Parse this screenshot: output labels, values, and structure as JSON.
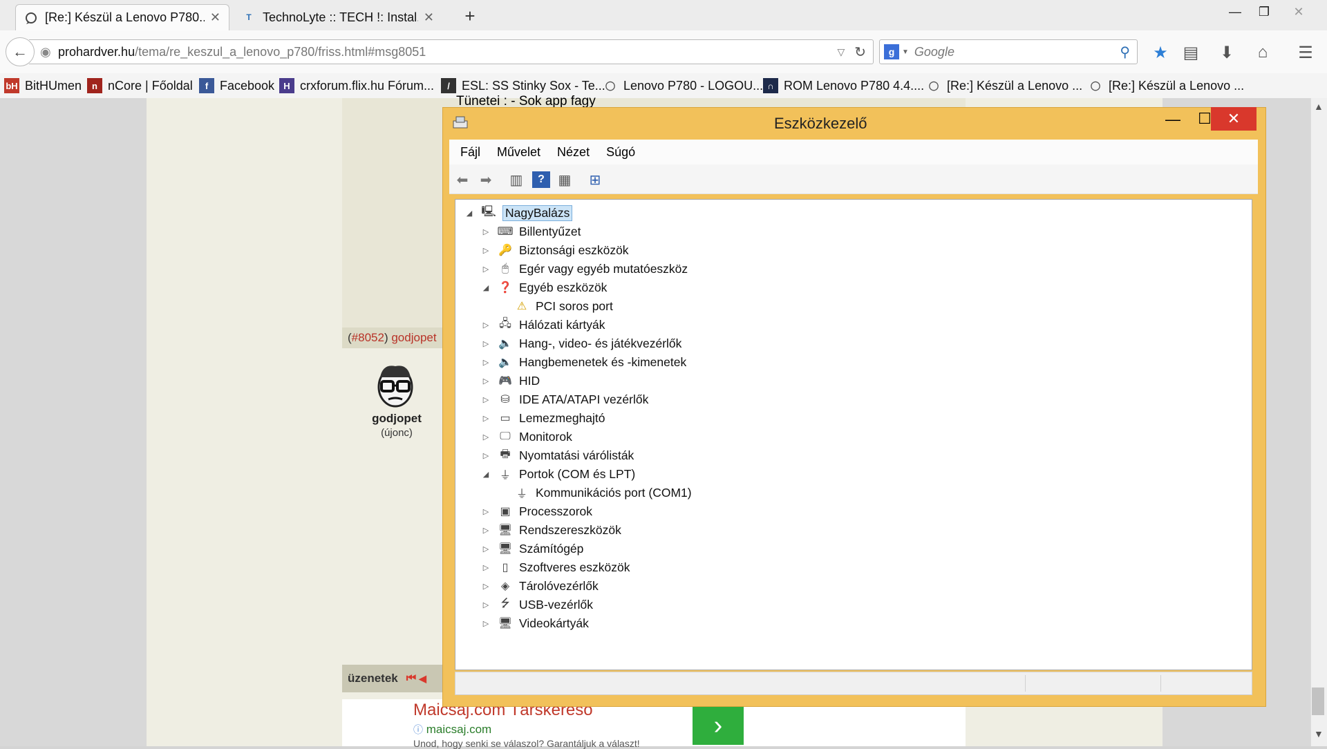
{
  "browser": {
    "tabs": [
      {
        "label": "[Re:] Készül a Lenovo P780...",
        "active": true
      },
      {
        "label": "TechnoLyte :: TECH !: Instal...",
        "active": false
      }
    ],
    "new_tab": "+",
    "url": {
      "host": "prohardver.hu",
      "path": "/tema/re_keszul_a_lenovo_p780/friss.html#msg8051"
    },
    "search_placeholder": "Google",
    "bookmarks": [
      {
        "label": "BitHUmen",
        "icon": "bithumen-icon",
        "color": "#c0392b"
      },
      {
        "label": "nCore | Főoldal",
        "icon": "ncore-icon",
        "color": "#a0241d"
      },
      {
        "label": "Facebook",
        "icon": "facebook-icon",
        "color": "#3b5998"
      },
      {
        "label": "crxforum.flix.hu Fórum...",
        "icon": "crx-icon",
        "color": "#4a3c8c"
      },
      {
        "label": "ESL: SS Stinky Sox - Te...",
        "icon": "esl-icon",
        "color": "#333333"
      },
      {
        "label": "Lenovo P780 - LOGOU...",
        "icon": "forum-icon",
        "color": "#555555"
      },
      {
        "label": "ROM Lenovo P780 4.4....",
        "icon": "rom-icon",
        "color": "#1d2a4a"
      },
      {
        "label": "[Re:] Készül a Lenovo ...",
        "icon": "forum-icon",
        "color": "#555555"
      },
      {
        "label": "[Re:] Készül a Lenovo ...",
        "icon": "forum-icon",
        "color": "#555555"
      }
    ]
  },
  "post": {
    "snippet": "Tünetei : - Sok app fagy",
    "number": "#8052",
    "author_link": "godjopet",
    "username": "godjopet",
    "rank": "(újonc)",
    "messages_label": "üzenetek"
  },
  "ad": {
    "title": "Maicsaj.com Társkereső",
    "url": "maicsaj.com",
    "subtitle": "Unod, hogy senki se válaszol? Garantáljuk a választ!",
    "button": "›"
  },
  "device_manager": {
    "title": "Eszközkezelő",
    "menu": [
      "Fájl",
      "Művelet",
      "Nézet",
      "Súgó"
    ],
    "root": "NagyBalázs",
    "nodes": [
      {
        "label": "Billentyűzet",
        "icon": "keyboard-icon",
        "expanded": false,
        "level": 1
      },
      {
        "label": "Biztonsági eszközök",
        "icon": "key-icon",
        "expanded": false,
        "level": 1
      },
      {
        "label": "Egér vagy egyéb mutatóeszköz",
        "icon": "mouse-icon",
        "expanded": false,
        "level": 1
      },
      {
        "label": "Egyéb eszközök",
        "icon": "unknown-device-icon",
        "expanded": true,
        "level": 1
      },
      {
        "label": "PCI soros port",
        "icon": "warning-device-icon",
        "expanded": null,
        "level": 2
      },
      {
        "label": "Hálózati kártyák",
        "icon": "network-icon",
        "expanded": false,
        "level": 1
      },
      {
        "label": "Hang-, video- és játékvezérlők",
        "icon": "speaker-icon",
        "expanded": false,
        "level": 1
      },
      {
        "label": "Hangbemenetek és -kimenetek",
        "icon": "speaker-icon",
        "expanded": false,
        "level": 1
      },
      {
        "label": "HID",
        "icon": "hid-icon",
        "expanded": false,
        "level": 1
      },
      {
        "label": "IDE ATA/ATAPI vezérlők",
        "icon": "ide-icon",
        "expanded": false,
        "level": 1
      },
      {
        "label": "Lemezmeghajtó",
        "icon": "disk-icon",
        "expanded": false,
        "level": 1
      },
      {
        "label": "Monitorok",
        "icon": "monitor-icon",
        "expanded": false,
        "level": 1
      },
      {
        "label": "Nyomtatási várólisták",
        "icon": "printer-icon",
        "expanded": false,
        "level": 1
      },
      {
        "label": "Portok (COM és LPT)",
        "icon": "port-icon",
        "expanded": true,
        "level": 1
      },
      {
        "label": "Kommunikációs port (COM1)",
        "icon": "port-icon",
        "expanded": null,
        "level": 2
      },
      {
        "label": "Processzorok",
        "icon": "cpu-icon",
        "expanded": false,
        "level": 1
      },
      {
        "label": "Rendszereszközök",
        "icon": "system-icon",
        "expanded": false,
        "level": 1
      },
      {
        "label": "Számítógép",
        "icon": "computer-icon",
        "expanded": false,
        "level": 1
      },
      {
        "label": "Szoftveres eszközök",
        "icon": "software-device-icon",
        "expanded": false,
        "level": 1
      },
      {
        "label": "Tárolóvezérlők",
        "icon": "storage-icon",
        "expanded": false,
        "level": 1
      },
      {
        "label": "USB-vezérlők",
        "icon": "usb-icon",
        "expanded": false,
        "level": 1
      },
      {
        "label": "Videokártyák",
        "icon": "display-adapter-icon",
        "expanded": false,
        "level": 1
      }
    ]
  }
}
